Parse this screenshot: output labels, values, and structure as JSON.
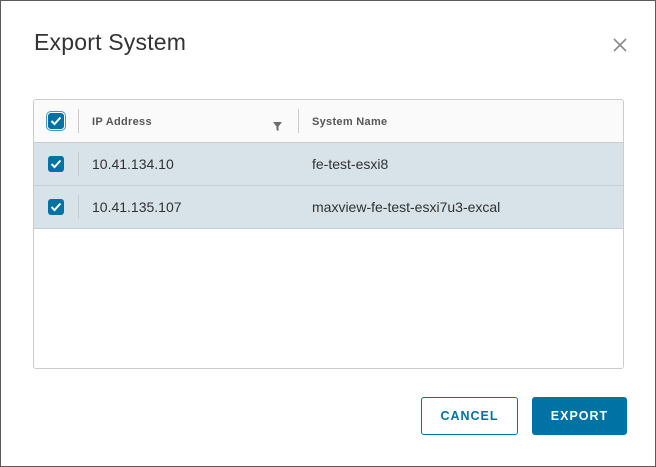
{
  "dialog": {
    "title": "Export System",
    "close_icon": "close-icon"
  },
  "grid": {
    "columns": [
      {
        "label": "IP Address",
        "has_filter": true
      },
      {
        "label": "System Name",
        "has_filter": false
      }
    ],
    "select_all_checked": true,
    "rows": [
      {
        "checked": true,
        "ip": "10.41.134.10",
        "name": "fe-test-esxi8"
      },
      {
        "checked": true,
        "ip": "10.41.135.107",
        "name": "maxview-fe-test-esxi7u3-excal"
      }
    ]
  },
  "footer": {
    "cancel_label": "CANCEL",
    "export_label": "EXPORT"
  },
  "colors": {
    "accent": "#0072a3",
    "selected_row": "#d8e3e9",
    "border": "#cccccc"
  }
}
